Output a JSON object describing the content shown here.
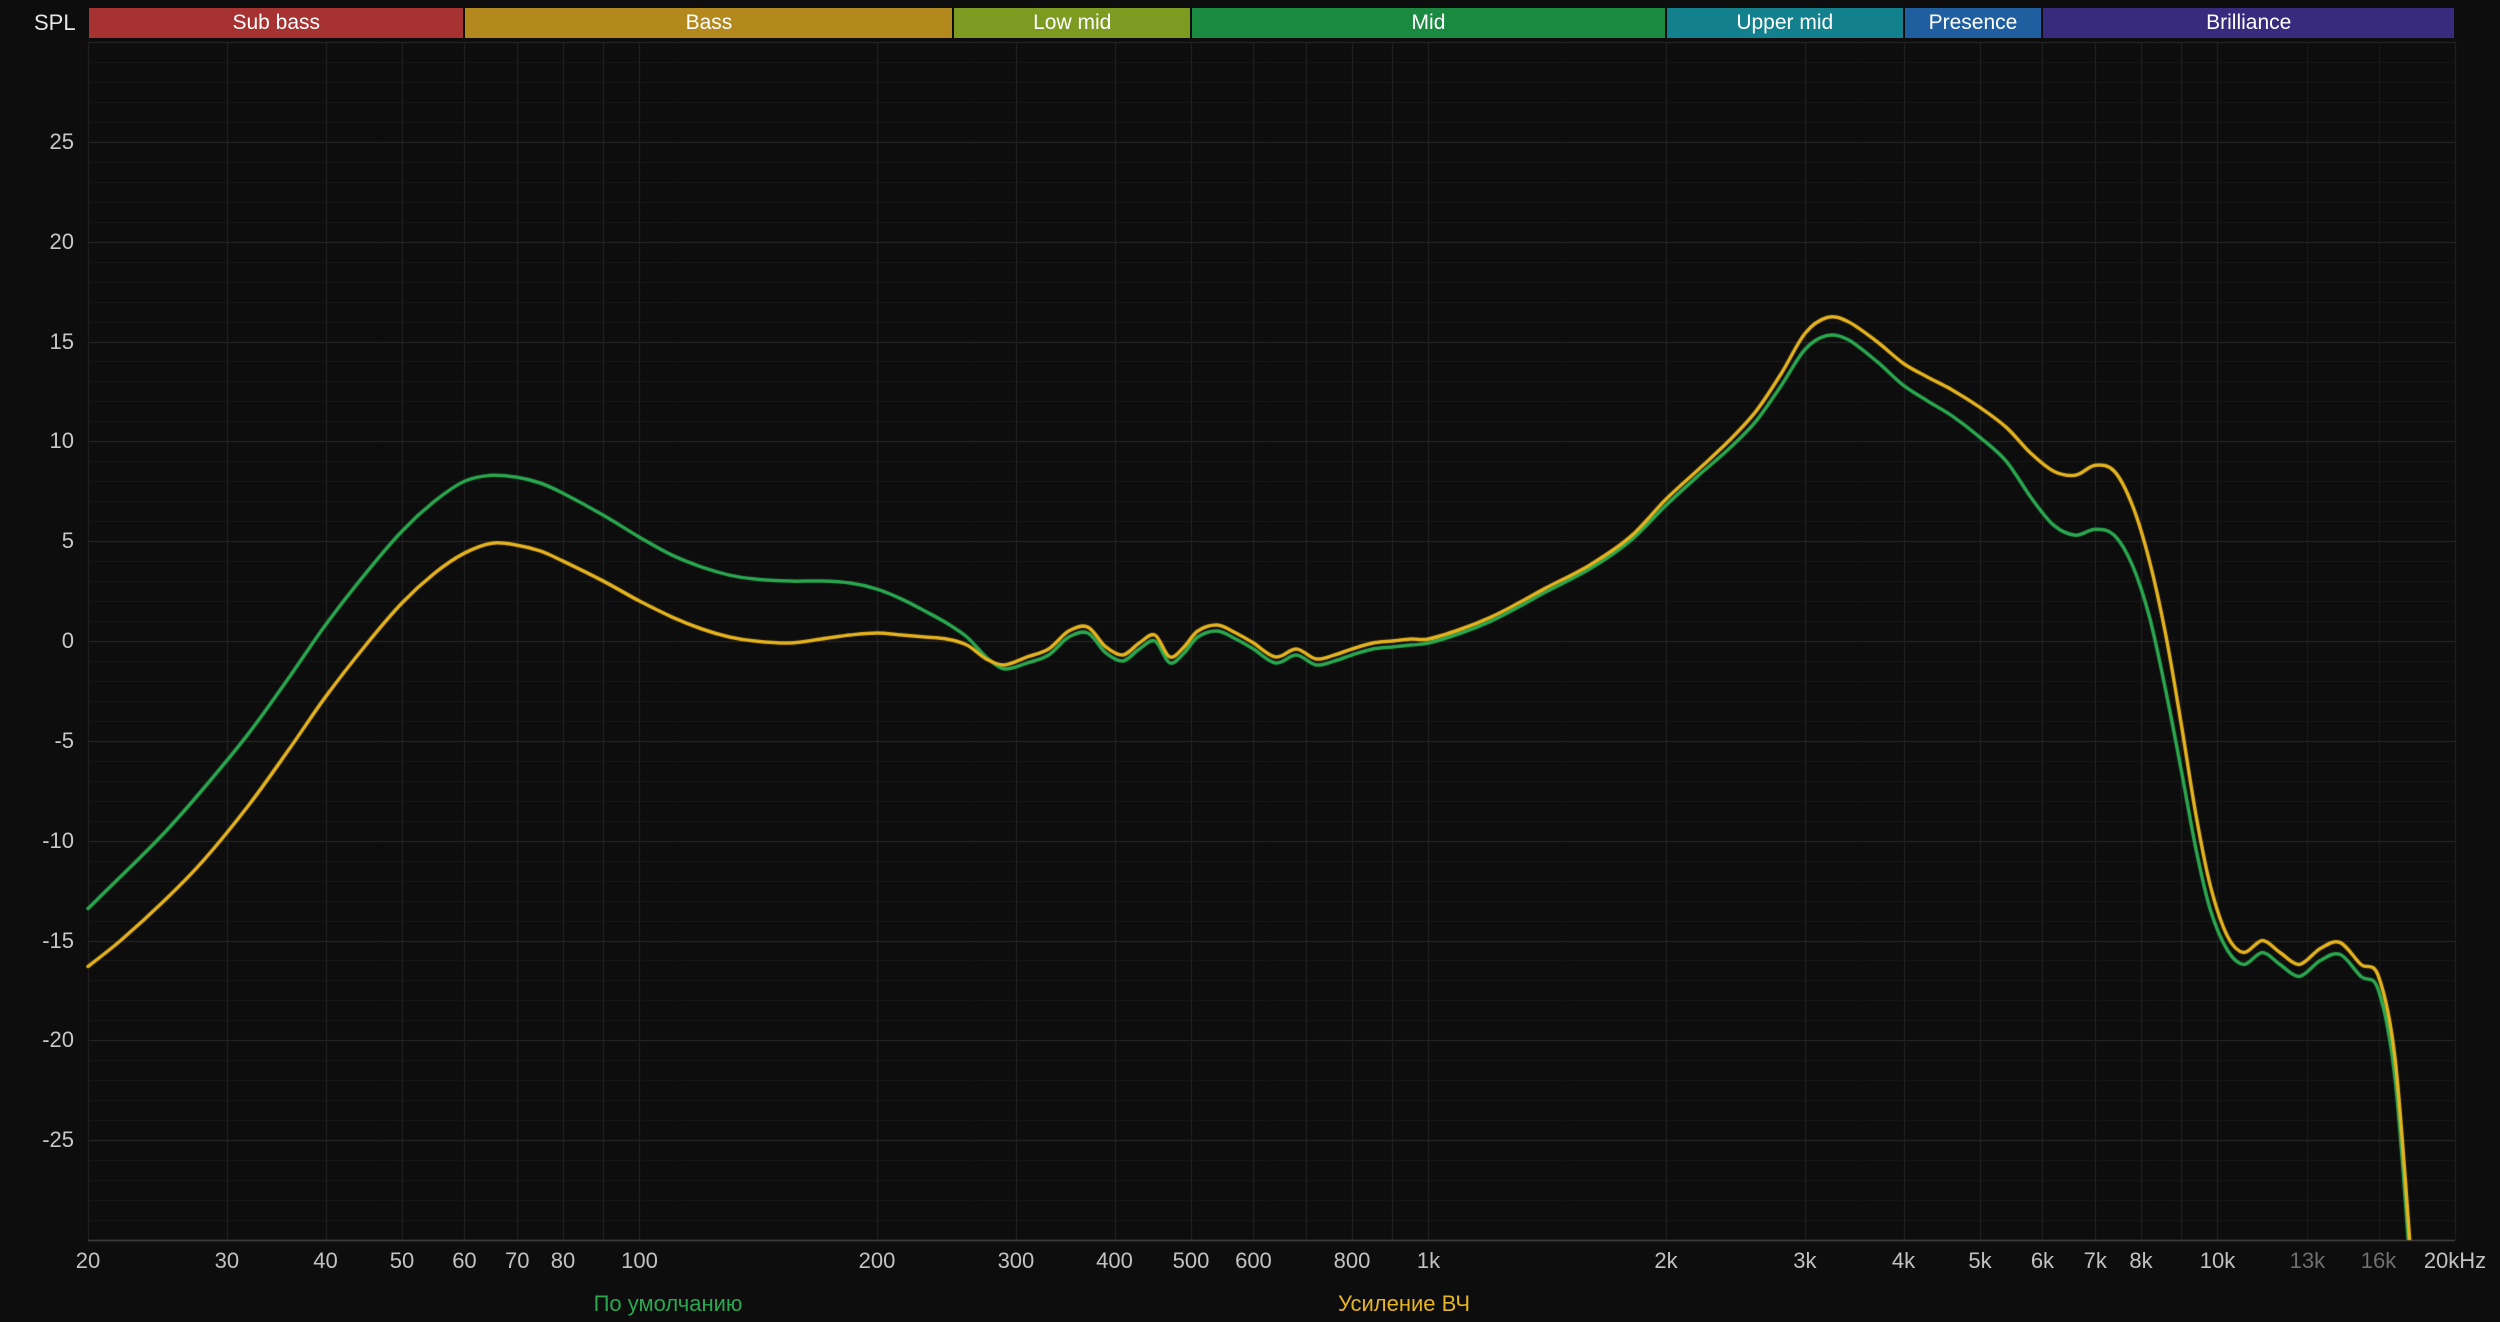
{
  "header": {
    "spl_label": "SPL"
  },
  "colors": {
    "background": "#0d0d0d",
    "grid_minor": "#181818",
    "grid_major": "#2a2a2a",
    "grid_vertical": "#232323",
    "grid_vertical_extra": "#1c1c1c",
    "axis_line": "#454545",
    "tick_text": "#c2c2c2",
    "tick_text_dim": "#6f6f6f",
    "band_text": "#ffffff"
  },
  "bands": [
    {
      "label": "Sub bass",
      "from": 20,
      "to": 60,
      "color": "#a63232"
    },
    {
      "label": "Bass",
      "from": 60,
      "to": 250,
      "color": "#b3891e"
    },
    {
      "label": "Low mid",
      "from": 250,
      "to": 500,
      "color": "#7c9b20"
    },
    {
      "label": "Mid",
      "from": 500,
      "to": 2000,
      "color": "#1b8a41"
    },
    {
      "label": "Upper mid",
      "from": 2000,
      "to": 4000,
      "color": "#12808d"
    },
    {
      "label": "Presence",
      "from": 4000,
      "to": 6000,
      "color": "#1f5fa0"
    },
    {
      "label": "Brilliance",
      "from": 6000,
      "to": 20000,
      "color": "#382a7d"
    }
  ],
  "axis": {
    "x_min": 20,
    "x_max": 20000,
    "y_min": -30,
    "y_max": 30,
    "y_major_step": 5,
    "y_minor_step": 1,
    "y_tick_values": [
      25,
      20,
      15,
      10,
      5,
      0,
      -5,
      -10,
      -15,
      -20,
      -25
    ],
    "x_ticks": [
      {
        "f": 20,
        "label": "20"
      },
      {
        "f": 30,
        "label": "30"
      },
      {
        "f": 40,
        "label": "40"
      },
      {
        "f": 50,
        "label": "50"
      },
      {
        "f": 60,
        "label": "60"
      },
      {
        "f": 70,
        "label": "70"
      },
      {
        "f": 80,
        "label": "80"
      },
      {
        "f": 100,
        "label": "100"
      },
      {
        "f": 200,
        "label": "200"
      },
      {
        "f": 300,
        "label": "300"
      },
      {
        "f": 400,
        "label": "400"
      },
      {
        "f": 500,
        "label": "500"
      },
      {
        "f": 600,
        "label": "600"
      },
      {
        "f": 800,
        "label": "800"
      },
      {
        "f": 1000,
        "label": "1k"
      },
      {
        "f": 2000,
        "label": "2k"
      },
      {
        "f": 3000,
        "label": "3k"
      },
      {
        "f": 4000,
        "label": "4k"
      },
      {
        "f": 5000,
        "label": "5k"
      },
      {
        "f": 6000,
        "label": "6k"
      },
      {
        "f": 7000,
        "label": "7k"
      },
      {
        "f": 8000,
        "label": "8k"
      },
      {
        "f": 10000,
        "label": "10k"
      },
      {
        "f": 13000,
        "label": "13k",
        "dim": true
      },
      {
        "f": 16000,
        "label": "16k",
        "dim": true
      },
      {
        "f": 20000,
        "label": "20kHz"
      }
    ],
    "extra_gridlines": [
      13000,
      16000
    ]
  },
  "legend": [
    {
      "label": "По умолчанию",
      "color": "#2aa84f"
    },
    {
      "label": "Усиление ВЧ",
      "color": "#e6b41e"
    }
  ],
  "chart_data": {
    "type": "line",
    "x_scale": "log",
    "title": "",
    "xlabel": "",
    "ylabel": "SPL",
    "x_range": [
      20,
      20000
    ],
    "y_range": [
      -30,
      30
    ],
    "grid": true,
    "legend_position": "bottom",
    "x": [
      20,
      22,
      25,
      28,
      32,
      36,
      40,
      45,
      50,
      55,
      60,
      65,
      70,
      75,
      80,
      90,
      100,
      110,
      120,
      130,
      140,
      155,
      170,
      185,
      200,
      215,
      230,
      245,
      260,
      275,
      290,
      310,
      330,
      350,
      370,
      390,
      410,
      430,
      450,
      470,
      490,
      510,
      540,
      570,
      600,
      640,
      680,
      720,
      760,
      800,
      850,
      900,
      950,
      1000,
      1100,
      1200,
      1300,
      1400,
      1600,
      1800,
      2000,
      2200,
      2400,
      2600,
      2800,
      3000,
      3200,
      3400,
      3700,
      4000,
      4300,
      4600,
      5000,
      5400,
      5800,
      6200,
      6600,
      7000,
      7400,
      7800,
      8200,
      8600,
      9000,
      9400,
      9800,
      10300,
      10800,
      11400,
      12000,
      12700,
      13500,
      14300,
      15200,
      16000,
      16800,
      17600
    ],
    "series": [
      {
        "name": "По умолчанию",
        "color": "#2aa84f",
        "values": [
          -13.4,
          -11.8,
          -9.6,
          -7.4,
          -4.6,
          -1.8,
          0.8,
          3.4,
          5.5,
          7.0,
          8.0,
          8.3,
          8.2,
          7.9,
          7.4,
          6.3,
          5.2,
          4.3,
          3.7,
          3.3,
          3.1,
          3.0,
          3.0,
          2.9,
          2.6,
          2.1,
          1.5,
          0.9,
          0.2,
          -0.8,
          -1.4,
          -1.1,
          -0.7,
          0.2,
          0.4,
          -0.6,
          -1.0,
          -0.4,
          0.0,
          -1.1,
          -0.6,
          0.2,
          0.5,
          0.1,
          -0.4,
          -1.1,
          -0.7,
          -1.2,
          -1.0,
          -0.7,
          -0.4,
          -0.3,
          -0.2,
          -0.1,
          0.4,
          1.0,
          1.7,
          2.4,
          3.6,
          5.0,
          6.8,
          8.3,
          9.6,
          11.0,
          12.8,
          14.6,
          15.3,
          15.1,
          14.0,
          12.8,
          12.0,
          11.3,
          10.2,
          9.0,
          7.2,
          5.8,
          5.3,
          5.6,
          5.3,
          3.8,
          1.2,
          -2.5,
          -6.5,
          -10.5,
          -13.5,
          -15.5,
          -16.2,
          -15.6,
          -16.2,
          -16.8,
          -16.0,
          -15.7,
          -16.8,
          -17.5,
          -22.0,
          -32.0
        ]
      },
      {
        "name": "Усиление ВЧ",
        "color": "#e6b41e",
        "values": [
          -16.3,
          -15.0,
          -13.0,
          -11.0,
          -8.2,
          -5.4,
          -2.8,
          -0.2,
          1.9,
          3.4,
          4.4,
          4.9,
          4.8,
          4.5,
          4.0,
          3.0,
          2.0,
          1.2,
          0.6,
          0.2,
          0.0,
          -0.1,
          0.1,
          0.3,
          0.4,
          0.3,
          0.2,
          0.1,
          -0.2,
          -0.9,
          -1.2,
          -0.8,
          -0.4,
          0.5,
          0.7,
          -0.3,
          -0.7,
          -0.1,
          0.3,
          -0.8,
          -0.3,
          0.5,
          0.8,
          0.4,
          -0.1,
          -0.8,
          -0.4,
          -0.9,
          -0.7,
          -0.4,
          -0.1,
          0.0,
          0.1,
          0.1,
          0.6,
          1.2,
          1.9,
          2.6,
          3.8,
          5.2,
          7.1,
          8.6,
          10.0,
          11.5,
          13.4,
          15.4,
          16.2,
          16.0,
          15.0,
          13.9,
          13.2,
          12.6,
          11.7,
          10.7,
          9.4,
          8.5,
          8.3,
          8.8,
          8.5,
          6.8,
          4.0,
          0.3,
          -4.2,
          -8.8,
          -12.3,
          -14.8,
          -15.6,
          -15.0,
          -15.6,
          -16.2,
          -15.4,
          -15.1,
          -16.2,
          -16.8,
          -21.0,
          -31.0
        ]
      }
    ]
  }
}
